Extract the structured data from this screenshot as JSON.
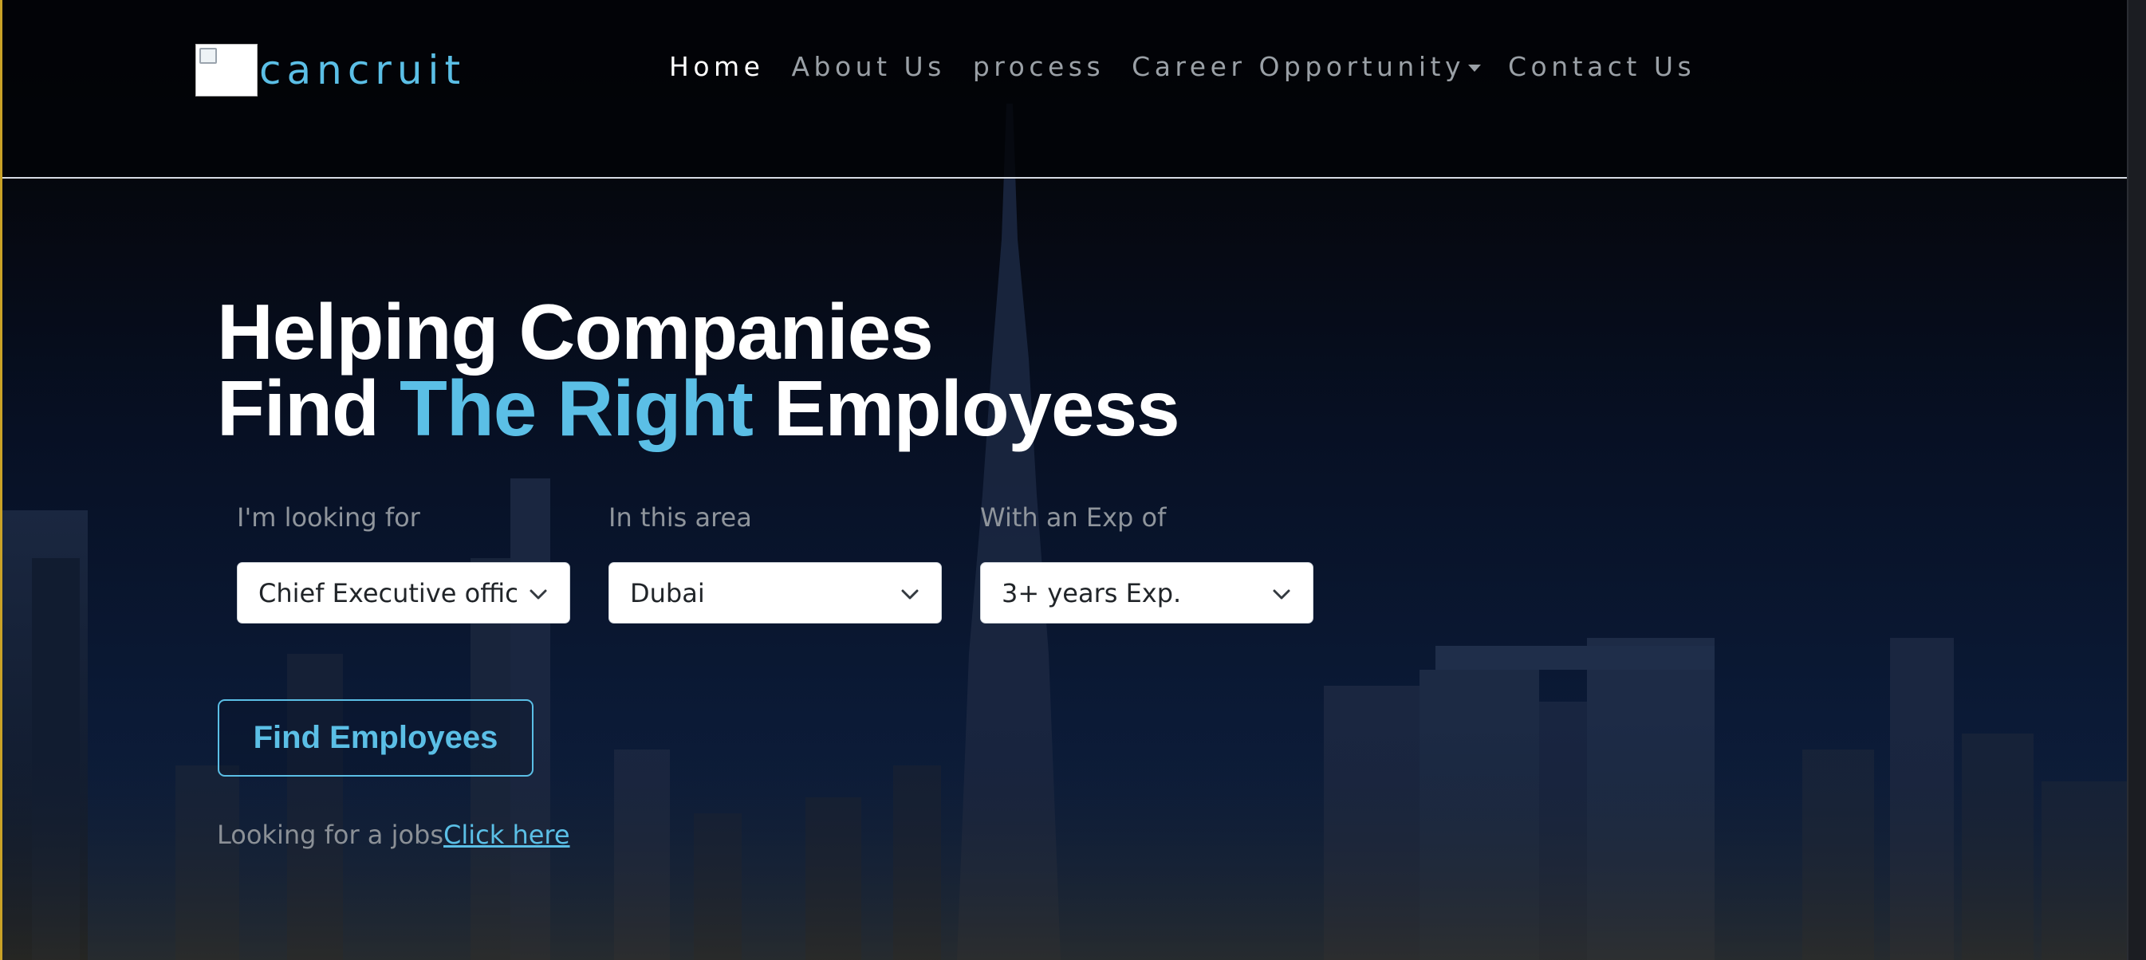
{
  "brand": {
    "name": "cancruit",
    "logo_icon": "broken-image-icon"
  },
  "nav": {
    "items": [
      {
        "label": "Home",
        "active": true
      },
      {
        "label": "About Us",
        "active": false
      },
      {
        "label": "process",
        "active": false
      },
      {
        "label": "Career Opportunity",
        "active": false,
        "has_dropdown": true
      },
      {
        "label": "Contact Us",
        "active": false
      }
    ]
  },
  "hero": {
    "line1": "Helping Companies",
    "line2_prefix": "Find ",
    "line2_accent": "The Right",
    "line2_suffix": " Employess"
  },
  "search": {
    "looking_for": {
      "label": "I'm looking for",
      "value": "Chief Executive officer"
    },
    "area": {
      "label": "In this area",
      "value": "Dubai"
    },
    "experience": {
      "label": "With an Exp of",
      "value": "3+ years Exp."
    }
  },
  "find_button": {
    "label": "Find Employees"
  },
  "jobs": {
    "prompt": "Looking for a jobs",
    "link_label": "Click here"
  },
  "colors": {
    "accent": "#5bbfe6",
    "nav_text": "#9aa0a6",
    "background": "#050811"
  }
}
